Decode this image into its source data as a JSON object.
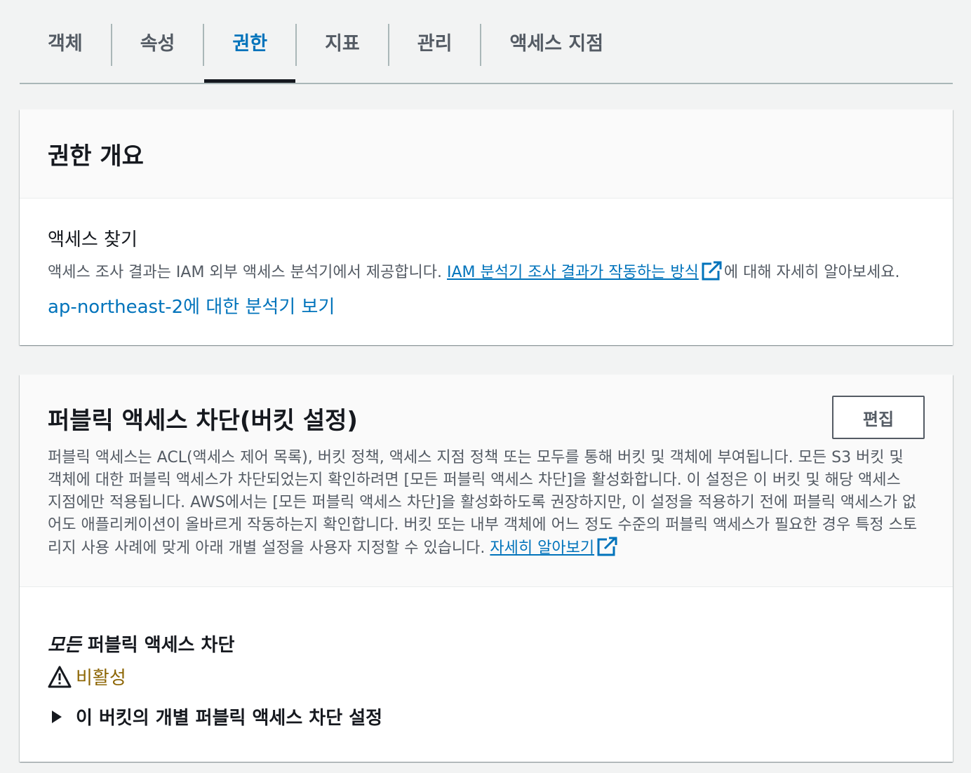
{
  "tabs": [
    {
      "label": "객체",
      "active": false
    },
    {
      "label": "속성",
      "active": false
    },
    {
      "label": "권한",
      "active": true
    },
    {
      "label": "지표",
      "active": false
    },
    {
      "label": "관리",
      "active": false
    },
    {
      "label": "액세스 지점",
      "active": false
    }
  ],
  "overview": {
    "title": "권한 개요",
    "access_finder": {
      "heading": "액세스 찾기",
      "text_before": "액세스 조사 결과는 IAM 외부 액세스 분석기에서 제공합니다. ",
      "link": "IAM 분석기 조사 결과가 작동하는 방식",
      "text_after": "에 대해 자세히 알아보세요.",
      "analyzer_link": "ap-northeast-2에 대한 분석기 보기"
    }
  },
  "block_public_access": {
    "title": "퍼블릭 액세스 차단(버킷 설정)",
    "edit_label": "편집",
    "description": "퍼블릭 액세스는 ACL(액세스 제어 목록), 버킷 정책, 액세스 지점 정책 또는 모두를 통해 버킷 및 객체에 부여됩니다. 모든 S3 버킷 및 객체에 대한 퍼블릭 액세스가 차단되었는지 확인하려면 [모든 퍼블릭 액세스 차단]을 활성화합니다. 이 설정은 이 버킷 및 해당 액세스 지점에만 적용됩니다. AWS에서는 [모든 퍼블릭 액세스 차단]을 활성화하도록 권장하지만, 이 설정을 적용하기 전에 퍼블릭 액세스가 없어도 애플리케이션이 올바르게 작동하는지 확인합니다. 버킷 또는 내부 객체에 어느 정도 수준의 퍼블릭 액세스가 필요한 경우 특정 스토리지 사용 사례에 맞게 아래 개별 설정을 사용자 지정할 수 있습니다. ",
    "learn_more": "자세히 알아보기",
    "block_all": {
      "title_em": "모든",
      "title_rest": " 퍼블릭 액세스 차단",
      "status": "비활성"
    },
    "individual_settings": "이 버킷의 개별 퍼블릭 액세스 차단 설정"
  },
  "colors": {
    "link": "#0073bb",
    "warning": "#8d6605",
    "active_tab": "#0073bb"
  },
  "icons": {
    "external": "external-link-icon",
    "warning": "warning-icon",
    "caret": "caret-right-icon"
  }
}
